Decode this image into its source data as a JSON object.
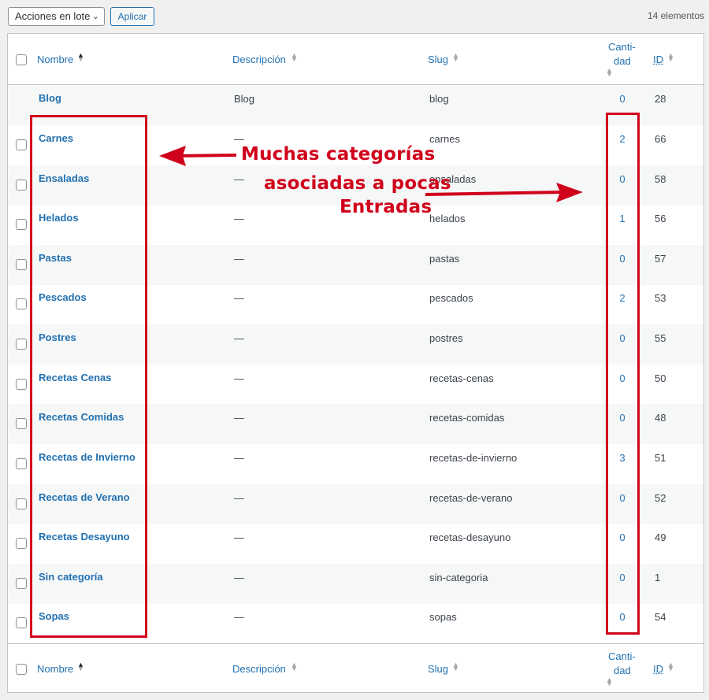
{
  "toolbar": {
    "bulk_actions": "Acciones en lote",
    "apply": "Aplicar",
    "count": "14 elementos"
  },
  "columns": {
    "name": "Nombre",
    "description": "Descripción",
    "slug": "Slug",
    "count_line1": "Canti-",
    "count_line2": "dad",
    "id": "ID"
  },
  "rows": [
    {
      "name": "Blog",
      "description": "Blog",
      "slug": "blog",
      "count": "0",
      "id": "28"
    },
    {
      "name": "Carnes",
      "description": "—",
      "slug": "carnes",
      "count": "2",
      "id": "66"
    },
    {
      "name": "Ensaladas",
      "description": "—",
      "slug": "ensaladas",
      "count": "0",
      "id": "58"
    },
    {
      "name": "Helados",
      "description": "—",
      "slug": "helados",
      "count": "1",
      "id": "56"
    },
    {
      "name": "Pastas",
      "description": "—",
      "slug": "pastas",
      "count": "0",
      "id": "57"
    },
    {
      "name": "Pescados",
      "description": "—",
      "slug": "pescados",
      "count": "2",
      "id": "53"
    },
    {
      "name": "Postres",
      "description": "—",
      "slug": "postres",
      "count": "0",
      "id": "55"
    },
    {
      "name": "Recetas Cenas",
      "description": "—",
      "slug": "recetas-cenas",
      "count": "0",
      "id": "50"
    },
    {
      "name": "Recetas Comidas",
      "description": "—",
      "slug": "recetas-comidas",
      "count": "0",
      "id": "48"
    },
    {
      "name": "Recetas de Invierno",
      "description": "—",
      "slug": "recetas-de-invierno",
      "count": "3",
      "id": "51"
    },
    {
      "name": "Recetas de Verano",
      "description": "—",
      "slug": "recetas-de-verano",
      "count": "0",
      "id": "52"
    },
    {
      "name": "Recetas Desayuno",
      "description": "—",
      "slug": "recetas-desayuno",
      "count": "0",
      "id": "49"
    },
    {
      "name": "Sin categoría",
      "description": "—",
      "slug": "sin-categoria",
      "count": "0",
      "id": "1"
    },
    {
      "name": "Sopas",
      "description": "—",
      "slug": "sopas",
      "count": "0",
      "id": "54"
    }
  ],
  "annotation": {
    "line1": "Muchas categorías",
    "line2": "asociadas a pocas",
    "line3": "Entradas",
    "color": "#d0021b"
  }
}
